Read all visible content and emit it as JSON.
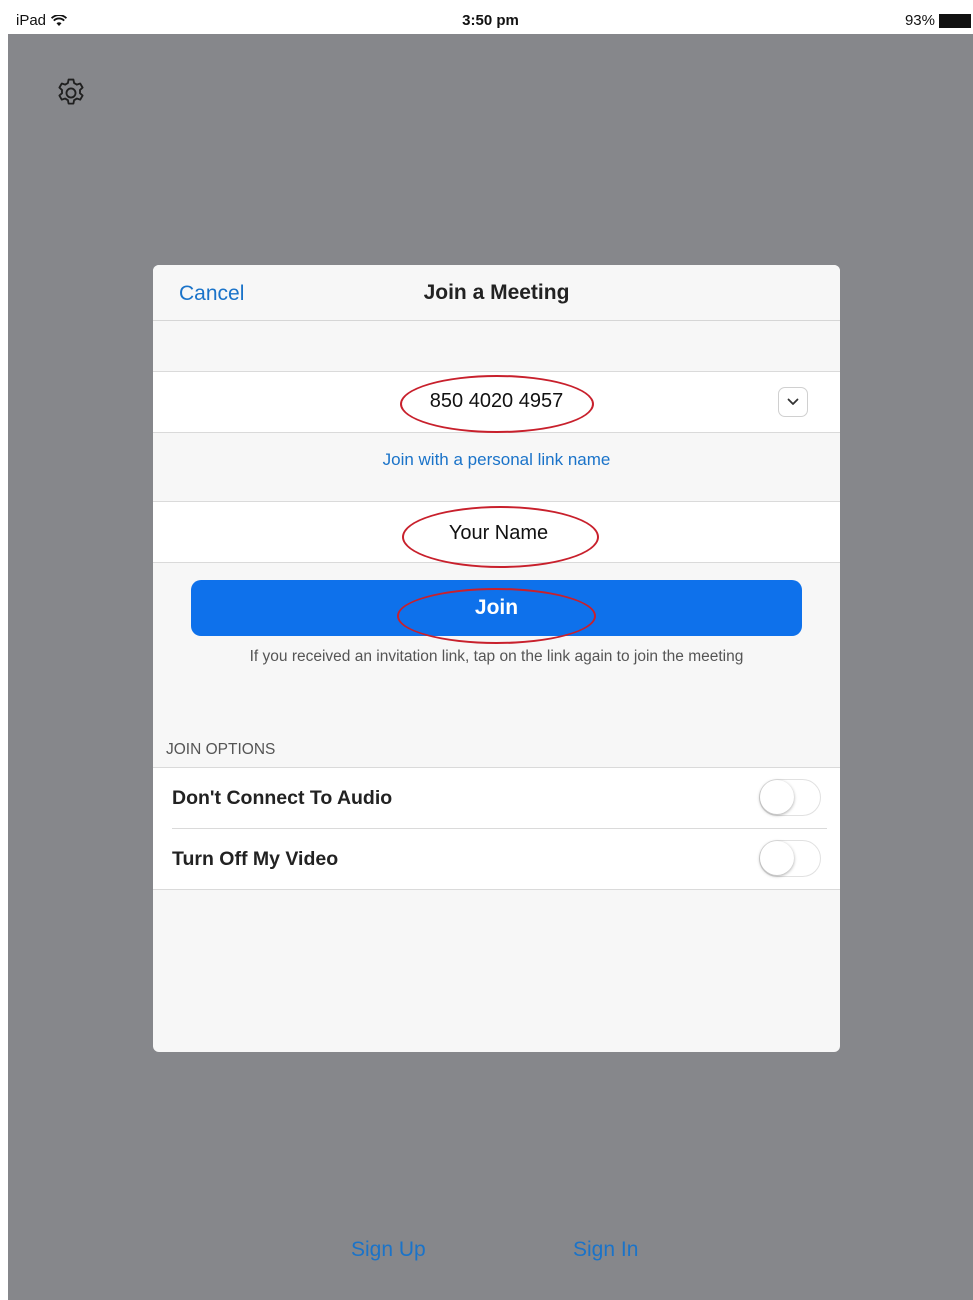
{
  "statusbar": {
    "device": "iPad",
    "time": "3:50 pm",
    "battery": "93%"
  },
  "settings": {
    "icon": "gear-icon"
  },
  "dialog": {
    "title": "Join a Meeting",
    "cancel_label": "Cancel",
    "meeting_id": "850 4020 4957",
    "personal_link_label": "Join with a personal link name",
    "name_value": "Your Name",
    "join_label": "Join",
    "hint": "If you received an invitation link, tap on the link again to join the meeting",
    "options_header": "JOIN OPTIONS",
    "options": [
      {
        "label": "Don't Connect To Audio",
        "enabled": false
      },
      {
        "label": "Turn Off My Video",
        "enabled": false
      }
    ]
  },
  "footer": {
    "sign_up": "Sign Up",
    "sign_in": "Sign In"
  },
  "colors": {
    "accent": "#1a73c9",
    "join_button": "#0e71eb",
    "annotation": "#c8202c",
    "backdrop": "#86878b"
  }
}
